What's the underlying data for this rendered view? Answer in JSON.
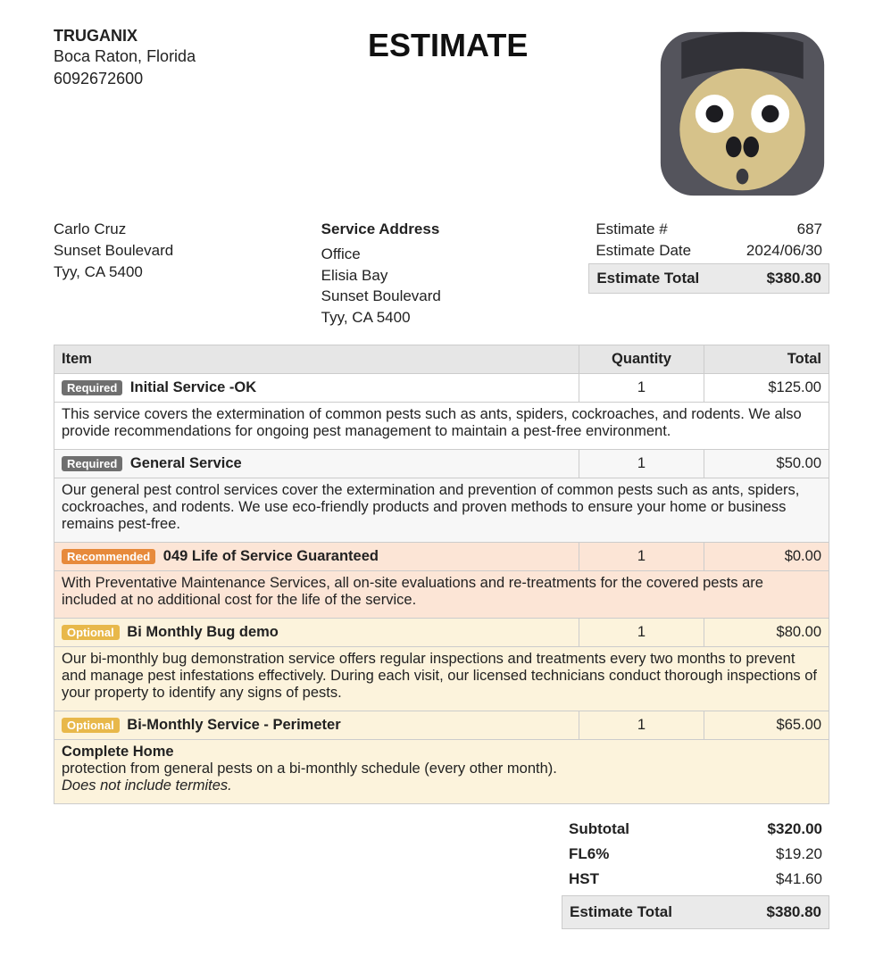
{
  "company": {
    "name": "TRUGANIX",
    "address": "Boca Raton, Florida",
    "phone": "6092672600"
  },
  "document_title": "ESTIMATE",
  "customer": {
    "name": "Carlo Cruz",
    "line1": "Sunset Boulevard",
    "line2": "Tyy, CA 5400"
  },
  "service_address": {
    "heading": "Service Address",
    "line1": "Office",
    "line2": "Elisia Bay",
    "line3": "Sunset Boulevard",
    "line4": "Tyy, CA 5400"
  },
  "estimate_meta": {
    "number_label": "Estimate #",
    "number": "687",
    "date_label": "Estimate Date",
    "date": "2024/06/30",
    "total_label": "Estimate Total",
    "total": "$380.80"
  },
  "columns": {
    "item": "Item",
    "qty": "Quantity",
    "total": "Total"
  },
  "items": [
    {
      "tag": "Required",
      "tag_class": "req",
      "row_class": "bg-white",
      "name": "Initial Service -OK",
      "qty": "1",
      "total": "$125.00",
      "desc_html": "This service covers the extermination of common pests such as ants, spiders, cockroaches, and rodents. We also provide recommendations for ongoing pest management to maintain a pest-free environment."
    },
    {
      "tag": "Required",
      "tag_class": "req",
      "row_class": "bg-grey",
      "name": "General Service",
      "qty": "1",
      "total": "$50.00",
      "desc_html": "Our general pest control services cover the extermination and prevention of common pests such as ants, spiders, cockroaches, and rodents. We use eco-friendly products and proven methods to ensure your home or business remains pest-free."
    },
    {
      "tag": "Recommended",
      "tag_class": "rec",
      "row_class": "bg-rec",
      "name": "049 Life of Service Guaranteed",
      "qty": "1",
      "total": "$0.00",
      "desc_html": "With Preventative Maintenance Services, all on-site evaluations and re-treatments for the covered pests are included at no additional cost for the life of the service."
    },
    {
      "tag": "Optional",
      "tag_class": "opt",
      "row_class": "bg-opt",
      "name": "Bi Monthly Bug demo",
      "qty": "1",
      "total": "$80.00",
      "desc_html": "Our bi-monthly bug demonstration service offers regular inspections and treatments every two months to prevent and manage pest infestations effectively. During each visit, our licensed technicians conduct thorough inspections of your property to identify any signs of pests."
    },
    {
      "tag": "Optional",
      "tag_class": "opt",
      "row_class": "bg-opt",
      "name": "Bi-Monthly Service - Perimeter",
      "qty": "1",
      "total": "$65.00",
      "desc_html": "<span class='bold'>Complete Home</span><br>protection from general pests on a bi-monthly schedule (every other month).<br><span class='italic'>Does not include termites.</span>"
    }
  ],
  "totals": {
    "subtotal_label": "Subtotal",
    "subtotal": "$320.00",
    "tax1_label": "FL6%",
    "tax1": "$19.20",
    "tax2_label": "HST",
    "tax2": "$41.60",
    "grand_label": "Estimate Total",
    "grand": "$380.80"
  }
}
